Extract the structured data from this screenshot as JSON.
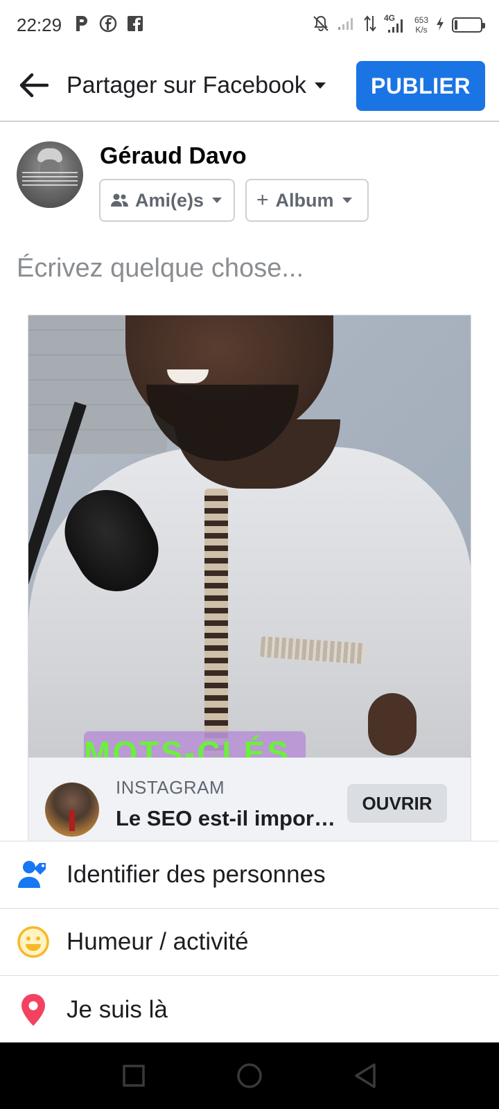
{
  "status_bar": {
    "time": "22:29",
    "network": "4G",
    "speed_value": "653",
    "speed_unit": "K/s",
    "battery_level": 0.12,
    "icons": [
      "p-icon",
      "facebook-messenger-icon",
      "facebook-icon",
      "bell-off-icon",
      "signal-icon",
      "data-arrows-icon",
      "signal-4g-icon",
      "charging-icon",
      "battery-icon"
    ]
  },
  "header": {
    "title": "Partager sur Facebook",
    "publish_label": "PUBLIER",
    "accent": "#1b74e4"
  },
  "author": {
    "name": "Géraud Davo",
    "audience_label": "Ami(e)s",
    "album_label": "Album"
  },
  "composer": {
    "placeholder": "Écrivez quelque chose..."
  },
  "shared_post": {
    "caption_overlay": "MOTS-CLÉS",
    "source": "INSTAGRAM",
    "title": "Le SEO est-il important ?",
    "open_label": "OUVRIR"
  },
  "actions": [
    {
      "label": "Identifier des personnes",
      "icon": "tag-people-icon",
      "color": "#1877f2"
    },
    {
      "label": "Humeur / activité",
      "icon": "smiley-icon",
      "color": "#f7b928"
    },
    {
      "label": "Je suis là",
      "icon": "location-pin-icon",
      "color": "#f3425f"
    }
  ]
}
